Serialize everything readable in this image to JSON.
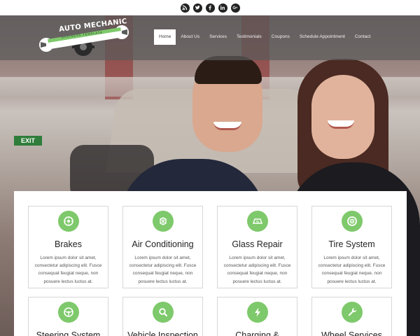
{
  "social": [
    {
      "name": "rss-icon"
    },
    {
      "name": "twitter-icon"
    },
    {
      "name": "facebook-icon"
    },
    {
      "name": "linkedin-icon"
    },
    {
      "name": "google-plus-icon"
    }
  ],
  "logo": {
    "title": "AUTO MECHANIC",
    "subtitle": "BUSINESS TEMPLATE"
  },
  "hero": {
    "exit_sign": "EXIT"
  },
  "nav": {
    "items": [
      {
        "label": "Home",
        "active": true
      },
      {
        "label": "About Us"
      },
      {
        "label": "Services"
      },
      {
        "label": "Testimonials"
      },
      {
        "label": "Coupons"
      },
      {
        "label": "Schedule Appointment"
      },
      {
        "label": "Contact"
      }
    ]
  },
  "colors": {
    "accent": "#7ec96b",
    "header_overlay": "#5a5a5a"
  },
  "services": [
    {
      "title": "Brakes",
      "icon": "brake-disc-icon",
      "text": "Lorem ipsum dolor sit amet, consectetur adipiscing elit. Fusce consequat feugiat neque, non posuere lectus luctus at."
    },
    {
      "title": "Air Conditioning",
      "icon": "snowflake-icon",
      "text": "Lorem ipsum dolor sit amet, consectetur adipiscing elit. Fusce consequat feugiat neque, non posuere lectus luctus at."
    },
    {
      "title": "Glass Repair",
      "icon": "windshield-icon",
      "text": "Lorem ipsum dolor sit amet, consectetur adipiscing elit. Fusce consequat feugiat neque, non posuere lectus luctus at."
    },
    {
      "title": "Tire System",
      "icon": "tire-icon",
      "text": "Lorem ipsum dolor sit amet, consectetur adipiscing elit. Fusce consequat feugiat neque, non posuere lectus luctus at."
    },
    {
      "title": "Steering System",
      "icon": "steering-wheel-icon",
      "text": ""
    },
    {
      "title": "Vehicle Inspection",
      "icon": "magnifier-icon",
      "text": ""
    },
    {
      "title": "Charging &",
      "icon": "lightning-icon",
      "text": ""
    },
    {
      "title": "Wheel Services",
      "icon": "wrench-icon",
      "text": ""
    }
  ]
}
